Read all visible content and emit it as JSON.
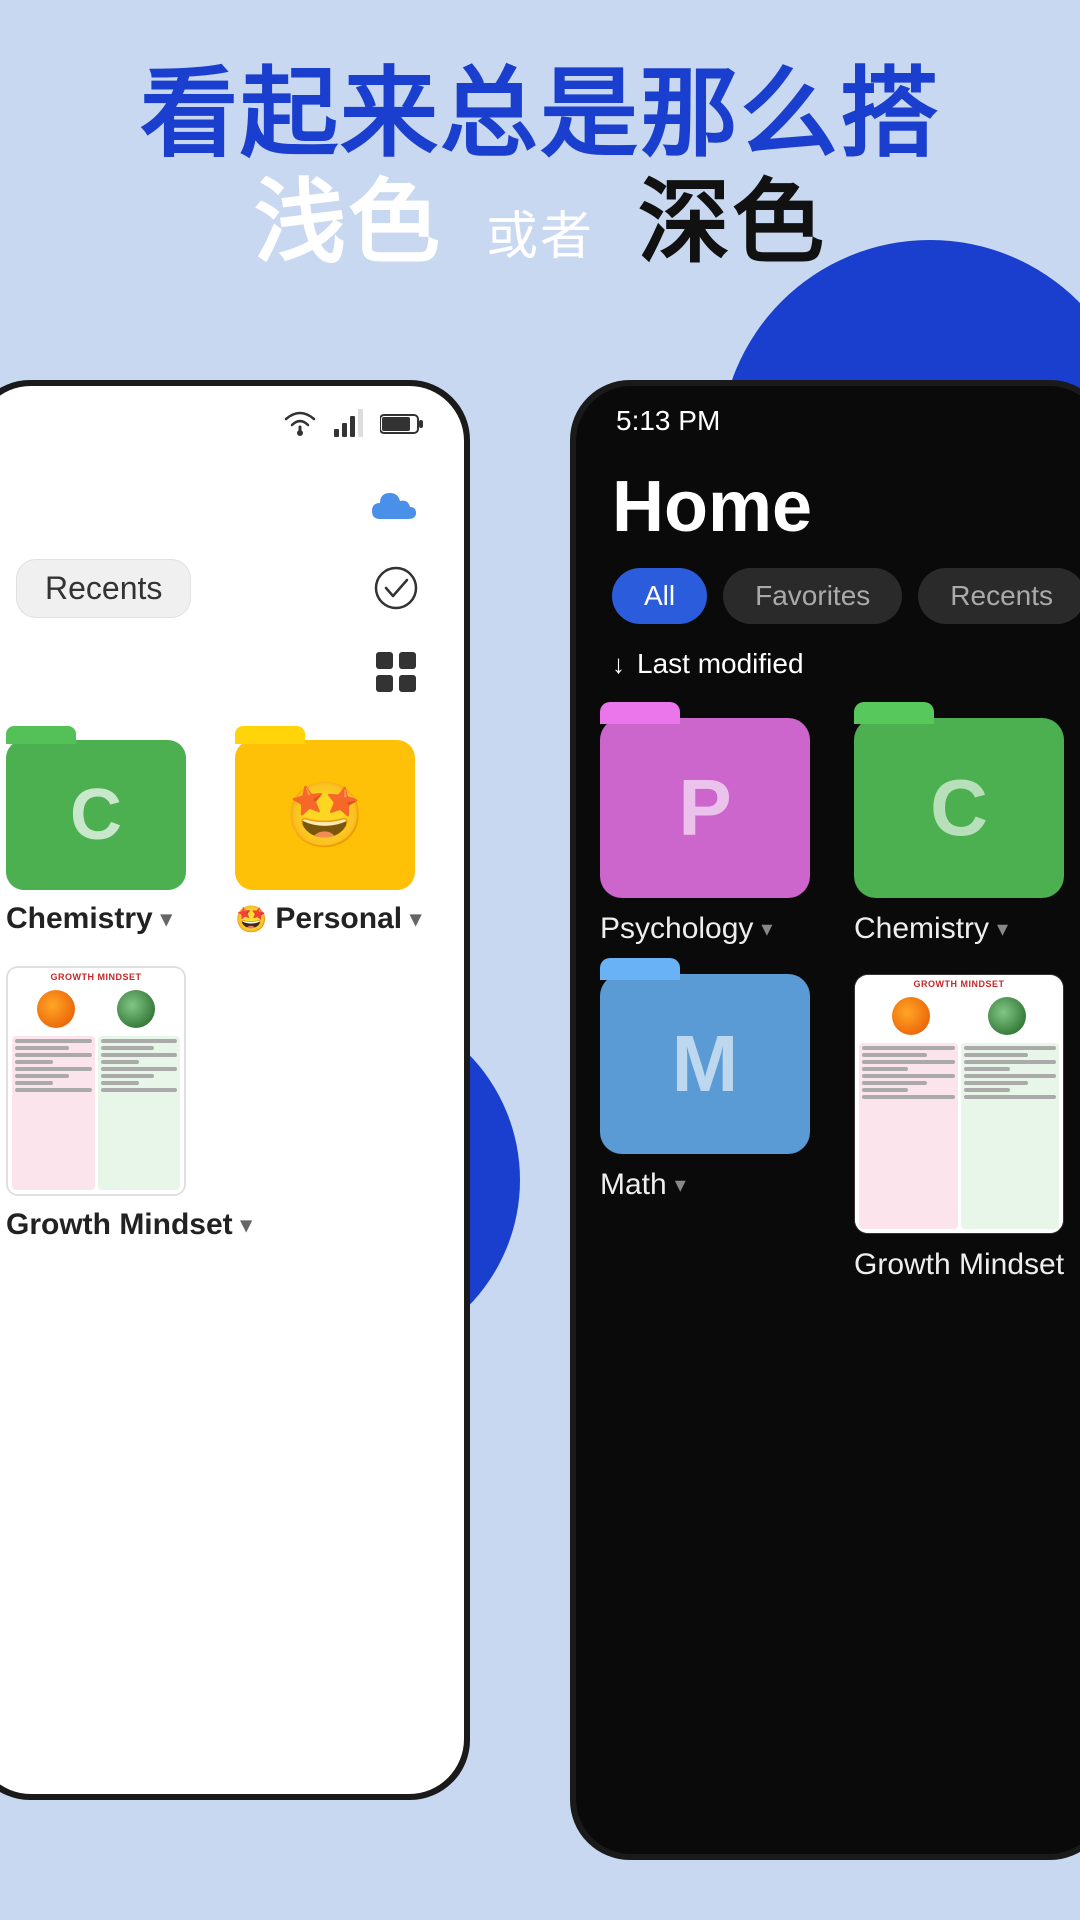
{
  "headline": {
    "line1": "看起来总是那么搭",
    "line2_light": "浅色",
    "line2_connector": "或者",
    "line2_dark": "深色"
  },
  "left_phone": {
    "status": {
      "wifi": "wifi",
      "signal": "signal",
      "battery": "battery"
    },
    "toolbar": {
      "recents_label": "Recents"
    },
    "folders": [
      {
        "label": "Chemistry",
        "color": "#4caf50",
        "initial": "C",
        "emoji": ""
      },
      {
        "label": "Personal",
        "color": "#ffc107",
        "initial": "",
        "emoji": "🤩"
      }
    ],
    "documents": [
      {
        "label": "Growth Mindset",
        "type": "pdf"
      }
    ]
  },
  "right_phone": {
    "status_time": "5:13 PM",
    "title": "Home",
    "filter_tabs": [
      {
        "label": "All",
        "active": true
      },
      {
        "label": "Favorites",
        "active": false
      },
      {
        "label": "Recents",
        "active": false
      }
    ],
    "sort_label": "Last modified",
    "folders": [
      {
        "label": "Psychology",
        "color": "#cc66cc",
        "initial": "P"
      },
      {
        "label": "Chemistry",
        "color": "#4caf50",
        "initial": "C"
      },
      {
        "label": "Math",
        "color": "#5b9bd5",
        "initial": "M"
      },
      {
        "label": "Growth Mindset",
        "type": "doc"
      }
    ]
  }
}
